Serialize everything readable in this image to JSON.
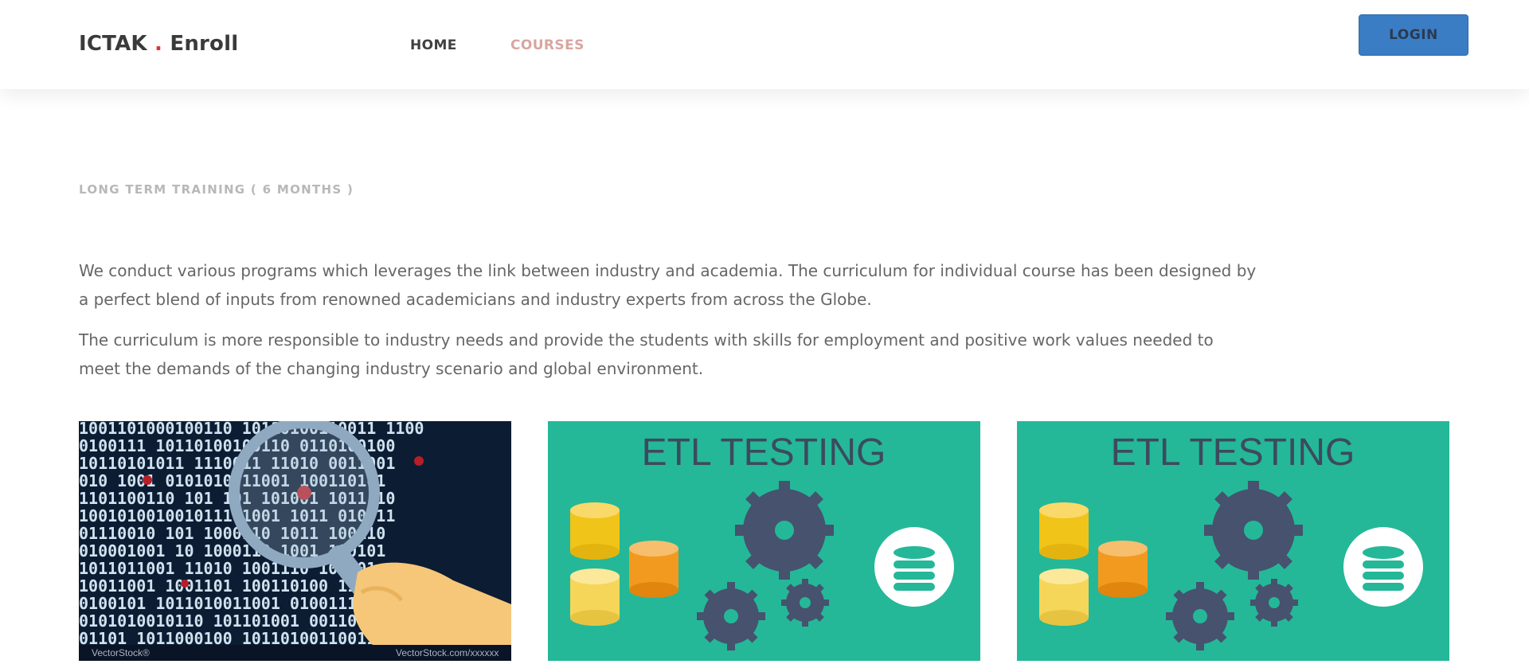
{
  "navbar": {
    "brand_main": "ICTAK",
    "brand_dot": ".",
    "brand_suffix": "Enroll",
    "links": [
      {
        "label": "HOME"
      },
      {
        "label": "COURSES"
      }
    ],
    "login_label": "LOGIN"
  },
  "section": {
    "title": "LONG TERM TRAINING ( 6 MONTHS )",
    "paragraphs": [
      "We conduct various programs which leverages the link between industry and academia. The curriculum for individual course has been designed by a perfect blend of inputs from renowned academicians and industry experts from across the Globe.",
      "The curriculum is more responsible to industry needs and provide the students with skills for employment and positive work values needed to meet the demands of the changing industry scenario and global environment."
    ]
  },
  "cards": [
    {
      "image_text": "",
      "watermark": "VectorStock®",
      "icon": "magnifier-binary-icon"
    },
    {
      "image_text": "ETL TESTING",
      "icon": "etl-gears-database-icon"
    },
    {
      "image_text": "ETL TESTING",
      "icon": "etl-gears-database-icon"
    }
  ],
  "colors": {
    "accent_dot": "#e1342e",
    "login_bg": "#3a7dc5",
    "courses_link": "#d8a6a0",
    "card_green": "#24b898",
    "gear": "#46526e"
  }
}
